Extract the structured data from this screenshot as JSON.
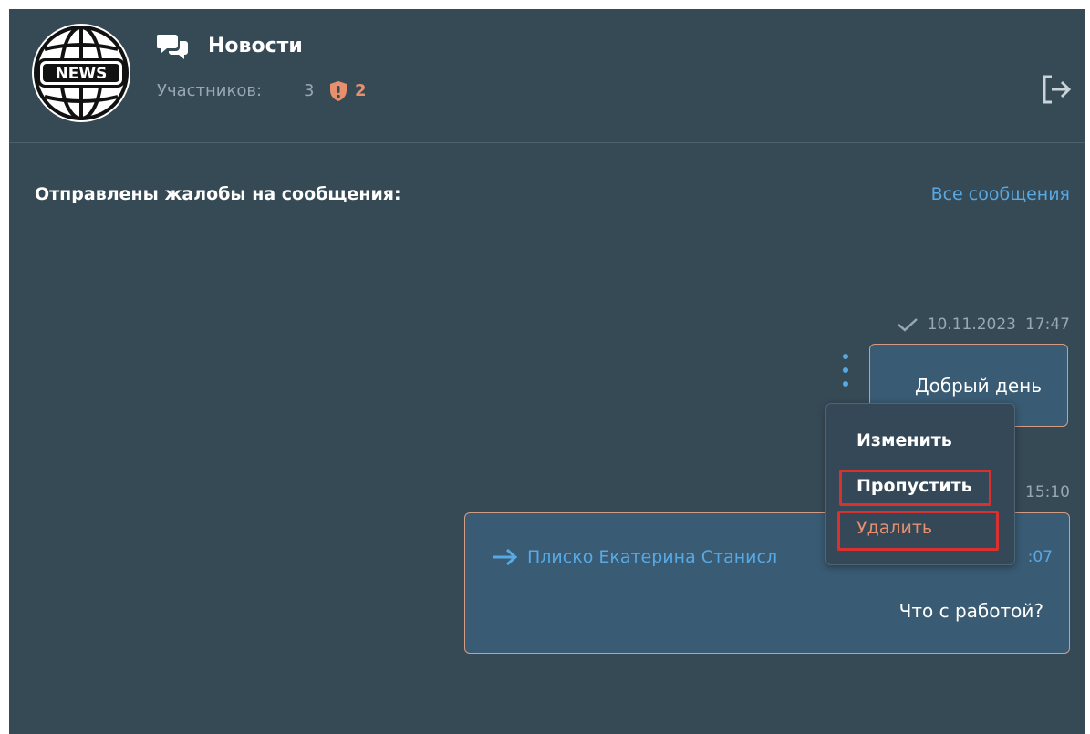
{
  "header": {
    "avatar_text": "NEWS",
    "chat_title": "Новости",
    "members_label": "Участников:",
    "members_count": "3",
    "reports_count": "2"
  },
  "section": {
    "title": "Отправлены жалобы на сообщения:",
    "all_messages_link": "Все сообщения"
  },
  "messages": [
    {
      "date": "10.11.2023",
      "time": "17:47",
      "status": "read",
      "text": "Добрый день"
    },
    {
      "time": "15:10",
      "forwarded_from": "Плиско Екатерина Станисл",
      "forwarded_time": ":07",
      "text": "Что с работой?"
    }
  ],
  "context_menu": {
    "items": [
      "Изменить",
      "Пропустить",
      "Удалить"
    ],
    "highlighted": [
      "Пропустить",
      "Удалить"
    ]
  },
  "colors": {
    "background": "#364a56",
    "message_bubble": "#395b73",
    "bubble_border": "#d39d85",
    "accent_blue": "#58a9e3",
    "accent_orange": "#e8906e",
    "muted_text": "#97a8b3",
    "highlight_red": "#d93030"
  },
  "icons": [
    "news-globe-icon",
    "chat-bubbles-icon",
    "shield-alert-icon",
    "exit-icon",
    "check-icon",
    "more-vertical-icon",
    "forward-arrow-icon"
  ]
}
